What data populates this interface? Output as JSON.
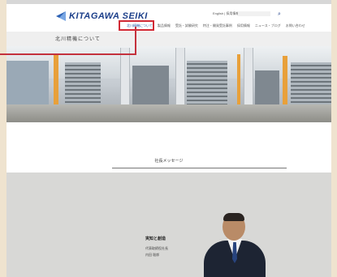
{
  "header": {
    "logo_text": "KITAGAWA SEIKI",
    "language_link": "English | 採用情報",
    "search_placeholder": "",
    "nav": [
      "北川精機について",
      "製品情報",
      "受託・試験研究",
      "特注・開発受託事例",
      "採用情報",
      "ニュース・ブログ",
      "お問い合わせ"
    ]
  },
  "page": {
    "title": "北川精機について"
  },
  "message_section": {
    "heading": "社長メッセージ",
    "block_heading": "実知と創造",
    "company": "代表取締役社長",
    "person": "内田 聡郎"
  },
  "colors": {
    "accent_red": "#d12a35",
    "brand_blue": "#1c3f8a",
    "background": "#efe3cf"
  }
}
